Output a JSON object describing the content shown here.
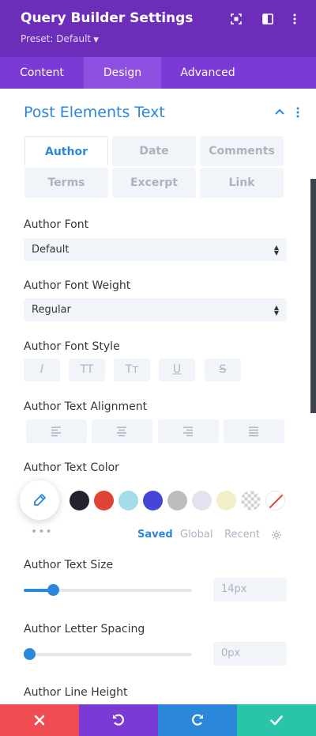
{
  "header": {
    "title": "Query Builder Settings",
    "preset": "Preset: Default",
    "bg_color": "#6c2eb9",
    "icons": [
      "expand-icon",
      "sidebar-icon",
      "more-vertical-icon"
    ]
  },
  "tabs": [
    {
      "label": "Content",
      "active": false
    },
    {
      "label": "Design",
      "active": true
    },
    {
      "label": "Advanced",
      "active": false
    }
  ],
  "section": {
    "title": "Post Elements Text",
    "accent_color": "#2b87da",
    "element_tabs": [
      {
        "label": "Author",
        "active": true
      },
      {
        "label": "Date",
        "active": false
      },
      {
        "label": "Comments",
        "active": false
      },
      {
        "label": "Terms",
        "active": false
      },
      {
        "label": "Excerpt",
        "active": false
      },
      {
        "label": "Link",
        "active": false
      }
    ]
  },
  "fields": {
    "font": {
      "label": "Author Font",
      "value": "Default"
    },
    "weight": {
      "label": "Author Font Weight",
      "value": "Regular"
    },
    "style": {
      "label": "Author Font Style",
      "buttons": [
        "I",
        "TT",
        "Tт",
        "U",
        "S"
      ]
    },
    "alignment": {
      "label": "Author Text Alignment",
      "options": [
        "left",
        "center",
        "right",
        "justify"
      ]
    },
    "color": {
      "label": "Author Text Color",
      "swatches": [
        "#23222e",
        "#e04434",
        "#a2dde8",
        "#4545d8",
        "#bdbdbd",
        "#e3e2f0",
        "#f2efc8",
        "transparent",
        "none"
      ],
      "tabs": [
        "Saved",
        "Global",
        "Recent"
      ]
    },
    "size": {
      "label": "Author Text Size",
      "value": "14px",
      "slider_fraction": 0.14
    },
    "letter_spacing": {
      "label": "Author Letter Spacing",
      "value": "0px",
      "slider_fraction": 0.0
    },
    "line_height": {
      "label": "Author Line Height"
    }
  },
  "footer": {
    "buttons": [
      {
        "name": "discard",
        "color": "#ef4d53"
      },
      {
        "name": "undo",
        "color": "#7b39d6"
      },
      {
        "name": "redo",
        "color": "#2b87da"
      },
      {
        "name": "save",
        "color": "#29c4a9"
      }
    ]
  }
}
